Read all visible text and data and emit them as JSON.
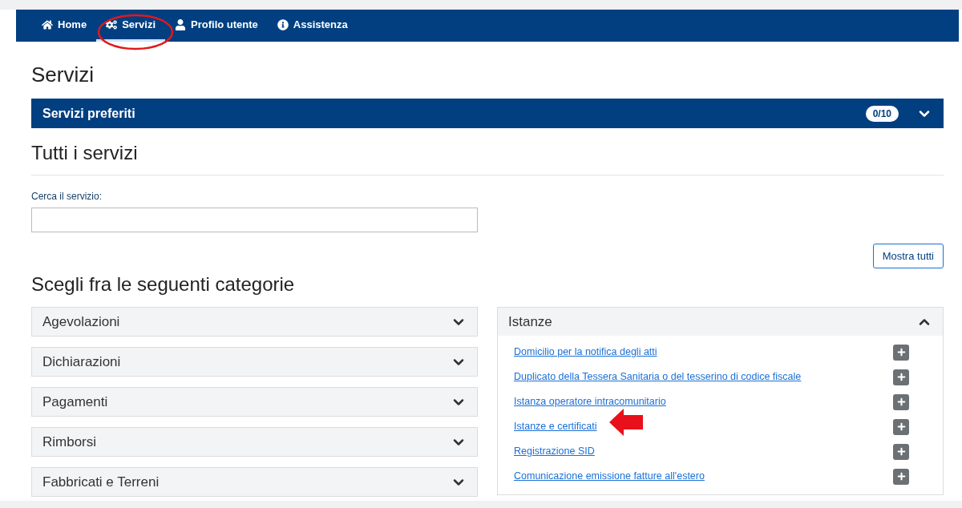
{
  "nav": {
    "items": [
      {
        "label": "Home",
        "selected": false
      },
      {
        "label": "Servizi",
        "selected": true
      },
      {
        "label": "Profilo utente",
        "selected": false
      },
      {
        "label": "Assistenza",
        "selected": false
      }
    ]
  },
  "page_title": "Servizi",
  "favorites": {
    "title": "Servizi preferiti",
    "count": "0/10",
    "expanded": false
  },
  "all_services": {
    "title": "Tutti i servizi",
    "search_label": "Cerca il servizio:",
    "show_all_button": "Mostra tutti"
  },
  "categories_title": "Scegli fra le seguenti categorie",
  "category_columns": [
    {
      "categories": [
        {
          "title": "Agevolazioni",
          "expanded": false
        },
        {
          "title": "Dichiarazioni",
          "expanded": false
        },
        {
          "title": "Pagamenti",
          "expanded": false
        },
        {
          "title": "Rimborsi",
          "expanded": false
        },
        {
          "title": "Fabbricati e Terreni",
          "expanded": false
        }
      ]
    },
    {
      "categories": [
        {
          "title": "Istanze",
          "expanded": true,
          "links": [
            "Domicilio per la notifica degli atti",
            "Duplicato della Tessera Sanitaria o del tesserino di codice fiscale",
            "Istanza operatore intracomunitario",
            "Istanze e certificati",
            "Registrazione SID",
            "Comunicazione emissione fatture all'estero"
          ]
        }
      ]
    }
  ]
}
